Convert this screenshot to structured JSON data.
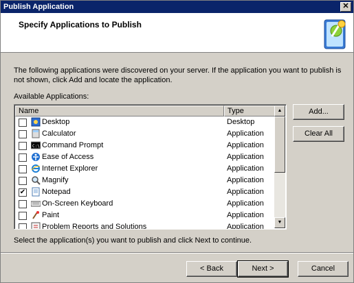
{
  "window": {
    "title": "Publish Application",
    "close_symbol": "✕"
  },
  "header": {
    "title": "Specify Applications to Publish"
  },
  "description": "The following applications were discovered on your server. If the application you want to publish is not shown, click Add and locate the application.",
  "available_label": "Available Applications:",
  "list": {
    "columns": {
      "name": "Name",
      "type": "Type"
    },
    "rows": [
      {
        "name": "Desktop",
        "type": "Desktop",
        "checked": false,
        "icon": "desktop-icon"
      },
      {
        "name": "Calculator",
        "type": "Application",
        "checked": false,
        "icon": "calculator-icon"
      },
      {
        "name": "Command Prompt",
        "type": "Application",
        "checked": false,
        "icon": "command-prompt-icon"
      },
      {
        "name": "Ease of Access",
        "type": "Application",
        "checked": false,
        "icon": "ease-of-access-icon"
      },
      {
        "name": "Internet Explorer",
        "type": "Application",
        "checked": false,
        "icon": "internet-explorer-icon"
      },
      {
        "name": "Magnify",
        "type": "Application",
        "checked": false,
        "icon": "magnify-icon"
      },
      {
        "name": "Notepad",
        "type": "Application",
        "checked": true,
        "icon": "notepad-icon"
      },
      {
        "name": "On-Screen Keyboard",
        "type": "Application",
        "checked": false,
        "icon": "keyboard-icon"
      },
      {
        "name": "Paint",
        "type": "Application",
        "checked": false,
        "icon": "paint-icon"
      },
      {
        "name": "Problem Reports and Solutions",
        "type": "Application",
        "checked": false,
        "icon": "problem-reports-icon"
      }
    ]
  },
  "buttons": {
    "add": "Add...",
    "clear_all": "Clear All",
    "back": "< Back",
    "next": "Next >",
    "cancel": "Cancel"
  },
  "instructions": "Select the application(s) you want to publish and click Next to continue.",
  "scrollbar": {
    "up_symbol": "▲",
    "down_symbol": "▼"
  }
}
